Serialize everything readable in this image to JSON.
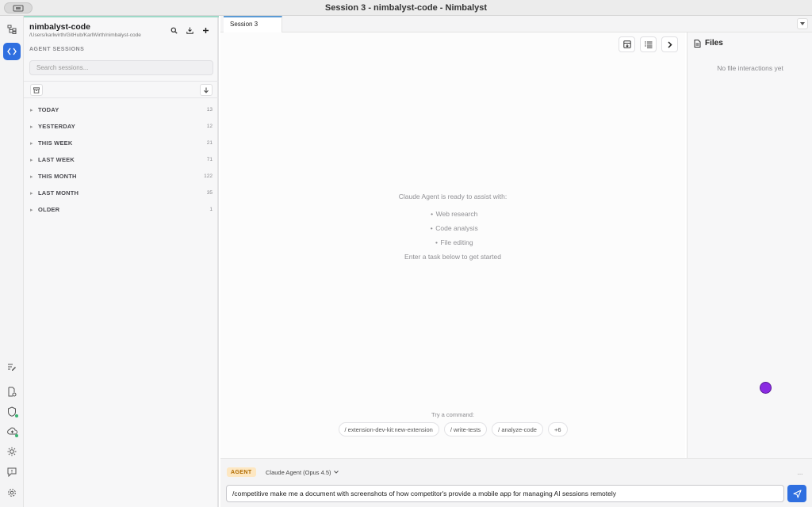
{
  "window": {
    "title": "Session 3 - nimbalyst-code - Nimbalyst"
  },
  "rail": {
    "icons": [
      "hierarchy-icon",
      "code-icon",
      "edit-list-icon",
      "doc-settings-icon",
      "shield-icon",
      "cloud-icon",
      "sun-icon",
      "feedback-icon",
      "gear-icon"
    ]
  },
  "sidebar": {
    "project_name": "nimbalyst-code",
    "project_path": "/Users/karlwirth/GitHub/KarlWirth/nimbalyst-code",
    "section_label": "AGENT SESSIONS",
    "search_placeholder": "Search sessions...",
    "groups": [
      {
        "label": "TODAY",
        "count": "13"
      },
      {
        "label": "YESTERDAY",
        "count": "12"
      },
      {
        "label": "THIS WEEK",
        "count": "21"
      },
      {
        "label": "LAST WEEK",
        "count": "71"
      },
      {
        "label": "THIS MONTH",
        "count": "122"
      },
      {
        "label": "LAST MONTH",
        "count": "35"
      },
      {
        "label": "OLDER",
        "count": "1"
      }
    ]
  },
  "tabs": [
    {
      "label": "Session 3",
      "active": true
    }
  ],
  "main": {
    "welcome_lead": "Claude Agent is ready to assist with:",
    "capabilities": [
      "Web research",
      "Code analysis",
      "File editing"
    ],
    "welcome_hint": "Enter a task below to get started",
    "try_label": "Try a command:",
    "commands": [
      "/ extension-dev-kit:new-extension",
      "/ write-tests",
      "/ analyze-code",
      "+6"
    ]
  },
  "files": {
    "title": "Files",
    "empty_text": "No file interactions yet"
  },
  "composer": {
    "mode_badge": "AGENT",
    "model": "Claude Agent (Opus 4.5)",
    "more": "...",
    "input_value": "/competitive make me a document with screenshots of how competitor's provide a mobile app for managing AI sessions remotely"
  },
  "colors": {
    "accent": "#2f6fe0",
    "agent_badge_bg": "#fde7c2",
    "agent_badge_text": "#b06b00",
    "cursor_dot": "#8a2be2"
  }
}
